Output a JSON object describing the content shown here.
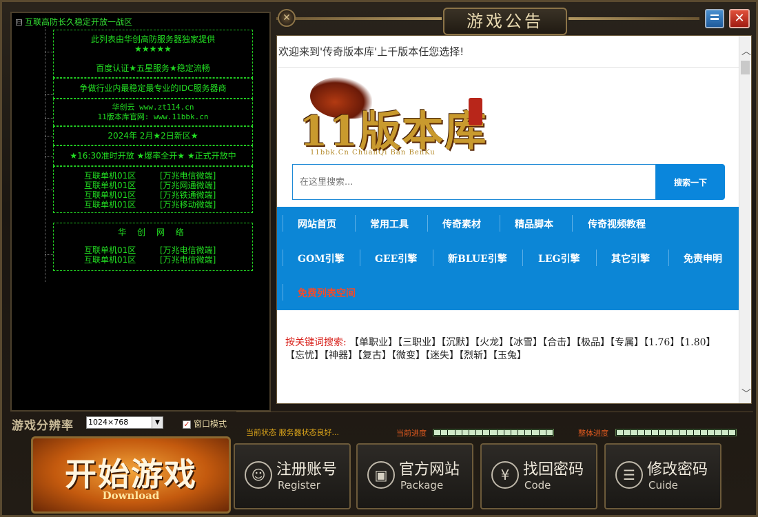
{
  "window": {
    "title": "游戏公告",
    "accent": "#0c86d6",
    "green": "#22dd22",
    "orange": "#e35b1f",
    "icons": [
      "close-ornament-icon",
      "minimize-icon",
      "close-icon"
    ]
  },
  "tree": {
    "root_label": "互联高防长久稳定开放一战区",
    "root_expander": "⊟",
    "node1": {
      "line1": "此列表由华创高防服务器独家提供",
      "line2": "★★★★★",
      "line3": "百度认证★五星服务★稳定流畅"
    },
    "node2": {
      "line1": "争做行业内最稳定最专业的IDC服务器商"
    },
    "node3": {
      "line1": "华创云    www.zt114.cn",
      "line2": "11版本库官网:    www.11bbk.cn"
    },
    "node4": {
      "line1": "2024年  2月★2日新区★"
    },
    "node5": {
      "line1": "★16:30准时开放  ★爆率全开★    ★正式开放中"
    },
    "node6": {
      "rows": [
        {
          "left": "互联单机01区",
          "right": "[万兆电信微端]"
        },
        {
          "left": "互联单机01区",
          "right": "[万兆网通微端]"
        },
        {
          "left": "互联单机01区",
          "right": "[万兆铁通微端]"
        },
        {
          "left": "互联单机01区",
          "right": "[万兆移动微端]"
        }
      ]
    },
    "node7": {
      "title": "华  创  网  络",
      "rows": [
        {
          "left": "互联单机01区",
          "right": "[万兆电信微端]"
        },
        {
          "left": "互联单机01区",
          "right": "[万兆电信微端]"
        }
      ]
    }
  },
  "browser": {
    "welcome": "欢迎来到'传奇版本库'上千版本任您选择!",
    "logo_main": "11版本库",
    "logo_sub": "11bbk.Cn ChuanQi Ban BenKu",
    "search_placeholder": "在这里搜索...",
    "search_button": "搜索一下",
    "nav_row1": [
      "网站首页",
      "常用工具",
      "传奇素材",
      "精品脚本",
      "传奇视频教程"
    ],
    "nav_row2": [
      "GOM引擎",
      "GEE引擎",
      "新BLUE引擎",
      "LEG引擎",
      "其它引擎",
      "免责申明"
    ],
    "nav_row3": [
      "免费列表空间"
    ],
    "keywords_label": "按关键词搜索:",
    "keywords": "【单职业】【三职业】【沉默】【火龙】【冰雪】【合击】【极品】【专属】【1.76】【1.80】【忘忧】【神器】【复古】【微变】【迷失】【烈斩】【玉兔】",
    "scroll_up": "︿",
    "scroll_down": "﹀"
  },
  "bottom": {
    "resolution_label": "游戏分辨率",
    "resolution_value": "1024×768",
    "window_mode_label": "窗口模式",
    "window_mode_checked": true,
    "status_label": "当前状态  服务器状态良好...",
    "progress_label": "当前进度",
    "overall_label": "整体进度",
    "progress_fraction": 1.0,
    "overall_fraction": 1.0,
    "start_main": "开始游戏",
    "start_sub": "Download",
    "actions": [
      {
        "main": "注册账号",
        "sub": "Register",
        "icon": "user-icon",
        "glyph": "☺"
      },
      {
        "main": "官方网站",
        "sub": "Package",
        "icon": "gift-icon",
        "glyph": "▣"
      },
      {
        "main": "找回密码",
        "sub": "Code",
        "icon": "yen-icon",
        "glyph": "¥"
      },
      {
        "main": "修改密码",
        "sub": "Cuide",
        "icon": "document-icon",
        "glyph": "☰"
      }
    ]
  }
}
